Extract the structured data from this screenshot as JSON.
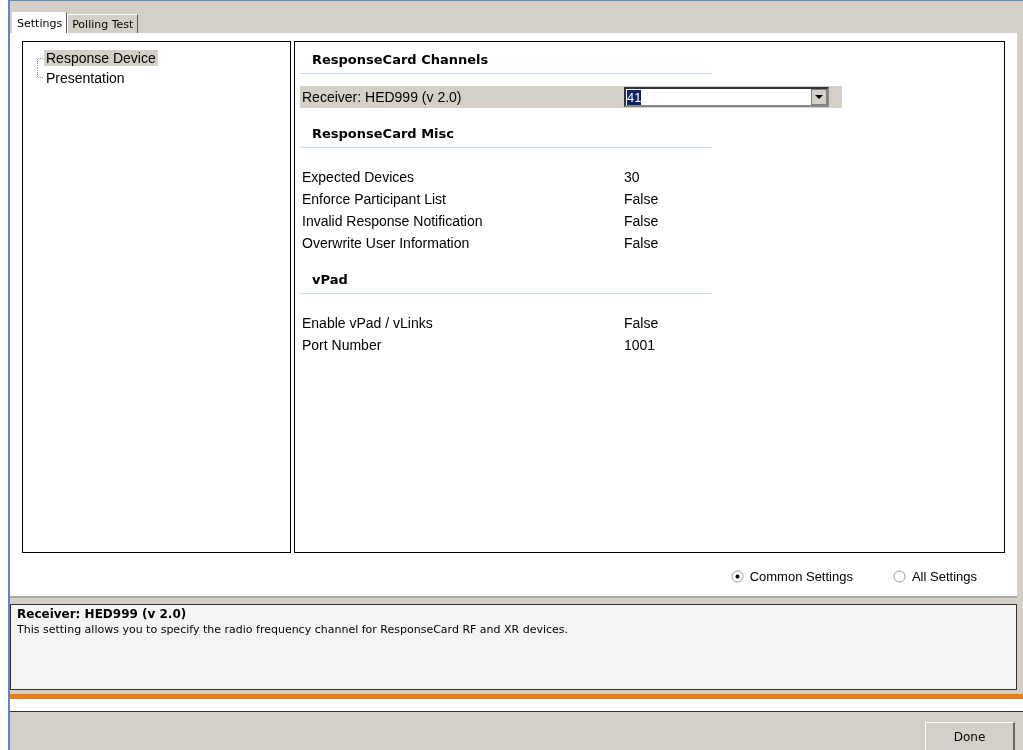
{
  "tabs": [
    {
      "label": "Settings",
      "selected": true
    },
    {
      "label": "Polling Test",
      "selected": false
    }
  ],
  "tree": [
    {
      "label": "Response Device",
      "selected": true
    },
    {
      "label": "Presentation",
      "selected": false
    }
  ],
  "sections": [
    {
      "heading": "ResponseCard Channels",
      "rows": [
        {
          "kind": "dropdown",
          "label": "Receiver: HED999 (v 2.0)",
          "value": "41",
          "selected": true
        }
      ]
    },
    {
      "heading": "ResponseCard Misc",
      "rows": [
        {
          "kind": "text",
          "label": "Expected Devices",
          "value": "30",
          "selected": false
        },
        {
          "kind": "text",
          "label": "Enforce Participant List",
          "value": "False",
          "selected": false
        },
        {
          "kind": "text",
          "label": "Invalid Response Notification",
          "value": "False",
          "selected": false
        },
        {
          "kind": "text",
          "label": "Overwrite User Information",
          "value": "False",
          "selected": false
        }
      ]
    },
    {
      "heading": "vPad",
      "rows": [
        {
          "kind": "text",
          "label": "Enable vPad / vLinks",
          "value": "False",
          "selected": false
        },
        {
          "kind": "text",
          "label": "Port Number",
          "value": "1001",
          "selected": false
        }
      ]
    }
  ],
  "view_options": [
    {
      "label": "Common Settings",
      "selected": true
    },
    {
      "label": "All Settings",
      "selected": false
    }
  ],
  "description": {
    "title": "Receiver: HED999 (v 2.0)",
    "text": "This setting allows you to specify the radio frequency channel for ResponseCard RF and XR devices."
  },
  "buttons": [
    "Done"
  ]
}
